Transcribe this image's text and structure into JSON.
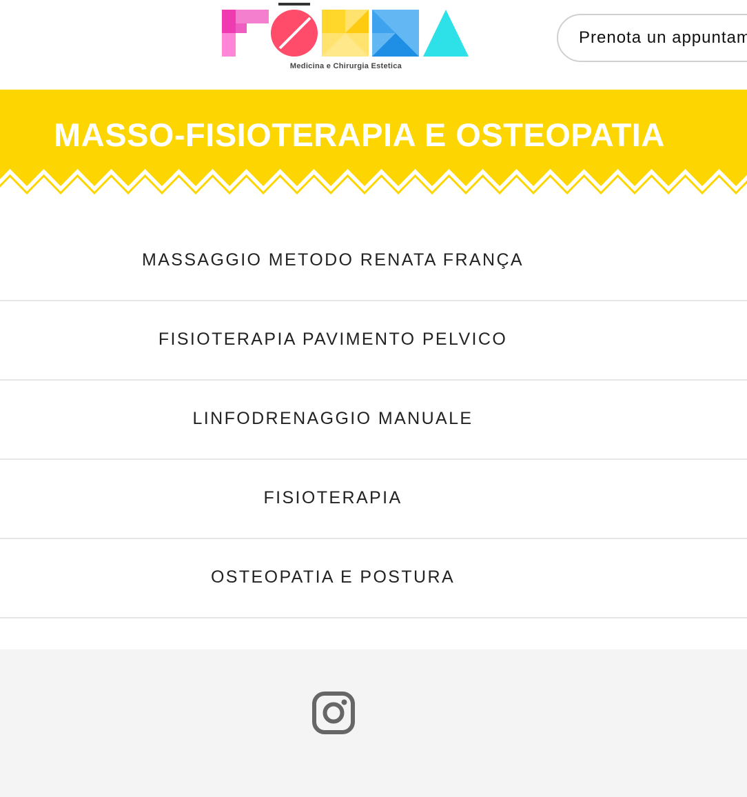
{
  "header": {
    "logo_text": "FŌRMA",
    "logo_tagline": "Medicina e Chirurgia Estetica",
    "cta_label": "Prenota un appuntamento"
  },
  "banner": {
    "title": "MASSO-FISIOTERAPIA E OSTEOPATIA",
    "color": "#FDD500"
  },
  "menu": {
    "items": [
      {
        "label": "MASSAGGIO METODO RENATA FRANÇA"
      },
      {
        "label": "FISIOTERAPIA PAVIMENTO PELVICO"
      },
      {
        "label": "LINFODRENAGGIO MANUALE"
      },
      {
        "label": "FISIOTERAPIA"
      },
      {
        "label": "OSTEOPATIA E POSTURA"
      }
    ]
  },
  "footer": {
    "social_icon": "instagram-icon"
  },
  "colors": {
    "pink": "#F03AB1",
    "red": "#FF4C6A",
    "yellow": "#FFD62A",
    "blue": "#1F8FE6",
    "cyan": "#2EE0E8"
  }
}
